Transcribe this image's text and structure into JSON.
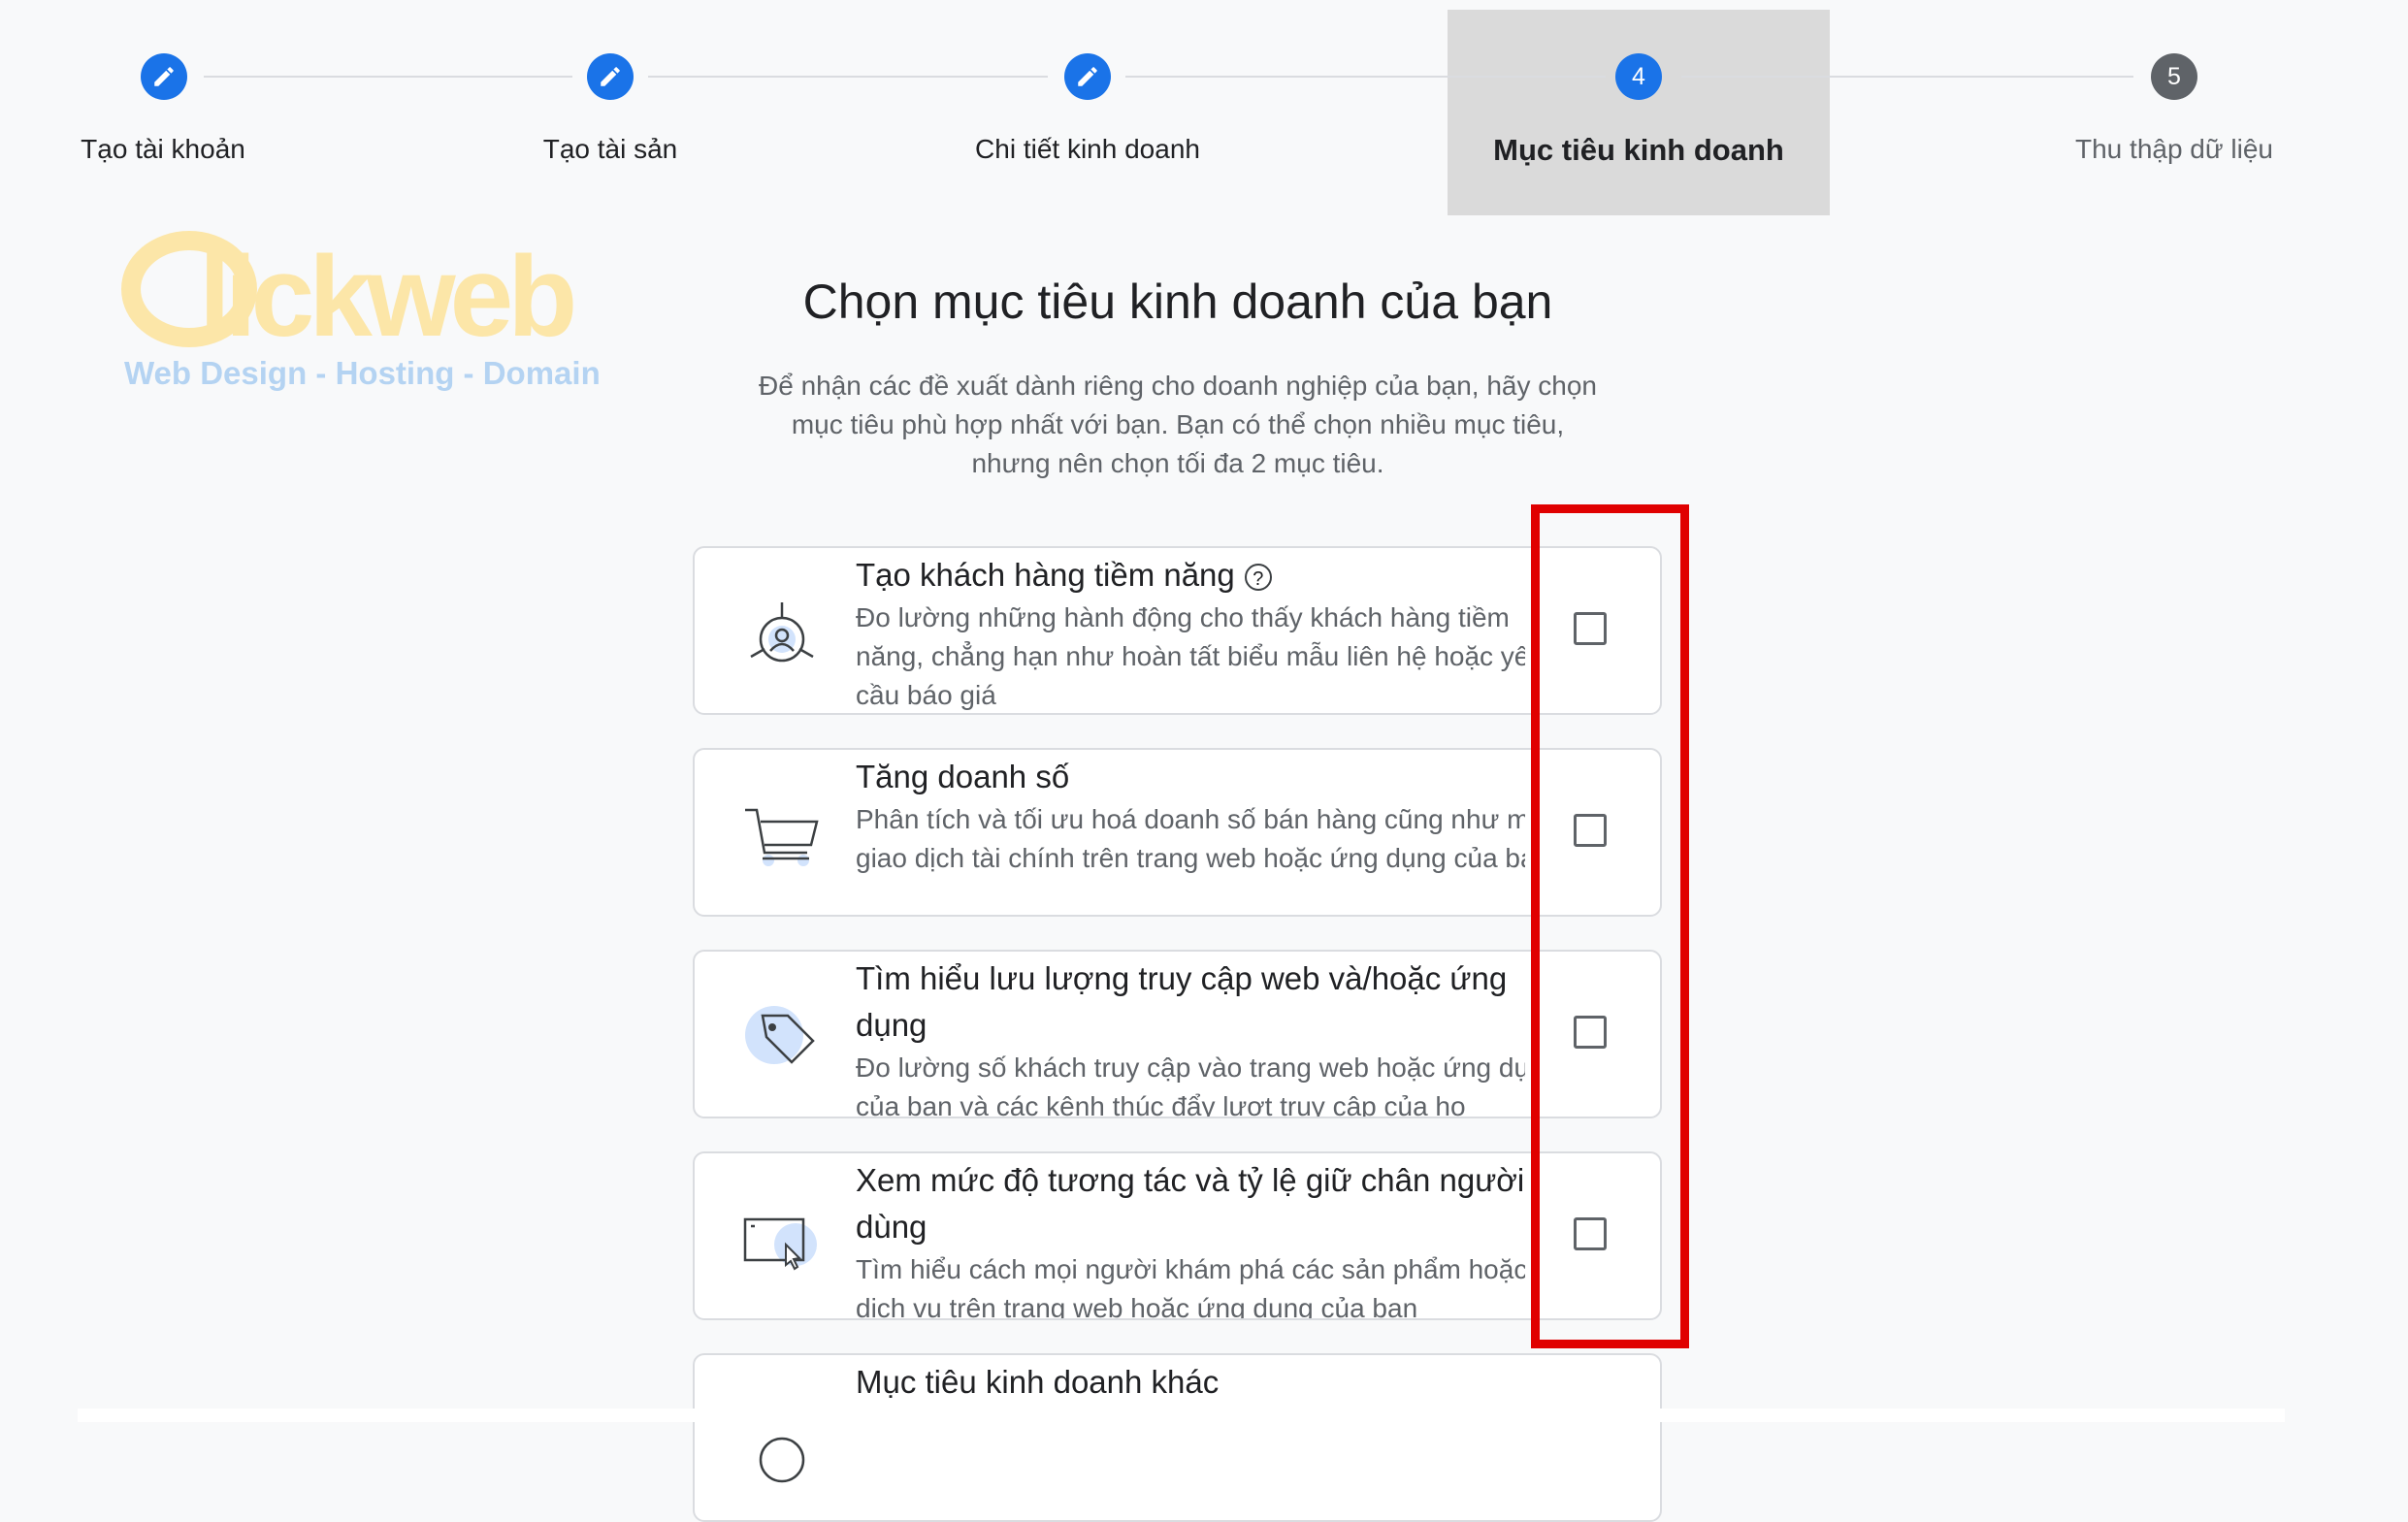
{
  "stepper": {
    "steps": [
      {
        "number": "1",
        "label": "Tạo tài khoản",
        "state": "done",
        "icon": "pencil-icon"
      },
      {
        "number": "2",
        "label": "Tạo tài sản",
        "state": "done",
        "icon": "pencil-icon"
      },
      {
        "number": "3",
        "label": "Chi tiết kinh doanh",
        "state": "done",
        "icon": "pencil-icon"
      },
      {
        "number": "4",
        "label": "Mục tiêu kinh doanh",
        "state": "active"
      },
      {
        "number": "5",
        "label": "Thu thập dữ liệu",
        "state": "pending"
      }
    ]
  },
  "watermark": {
    "brand": "lickweb",
    "tagline": "Web Design - Hosting - Domain"
  },
  "main": {
    "title": "Chọn mục tiêu kinh doanh của bạn",
    "description": "Để nhận các đề xuất dành riêng cho doanh nghiệp của bạn, hãy chọn mục tiêu phù hợp nhất với bạn. Bạn có thể chọn nhiều mục tiêu, nhưng nên chọn tối đa 2 mục tiêu."
  },
  "goals": [
    {
      "title": "Tạo khách hàng tiềm năng",
      "description": "Đo lường những hành động cho thấy khách hàng tiềm năng, chẳng hạn như hoàn tất biểu mẫu liên hệ hoặc yêu cầu báo giá",
      "icon": "lead-target-icon",
      "has_help": true,
      "checked": false
    },
    {
      "title": "Tăng doanh số",
      "description": "Phân tích và tối ưu hoá doanh số bán hàng cũng như mọi giao dịch tài chính trên trang web hoặc ứng dụng của bạn",
      "icon": "shopping-cart-icon",
      "has_help": false,
      "checked": false
    },
    {
      "title": "Tìm hiểu lưu lượng truy cập web và/hoặc ứng dụng",
      "description": "Đo lường số khách truy cập vào trang web hoặc ứng dụng của bạn và các kênh thúc đẩy lượt truy cập của họ",
      "icon": "tag-icon",
      "has_help": false,
      "checked": false
    },
    {
      "title": "Xem mức độ tương tác và tỷ lệ giữ chân người dùng",
      "description": "Tìm hiểu cách mọi người khám phá các sản phẩm hoặc dịch vụ trên trang web hoặc ứng dụng của bạn",
      "icon": "browser-cursor-icon",
      "has_help": false,
      "checked": false
    },
    {
      "title": "Mục tiêu kinh doanh khác",
      "description": "",
      "icon": "other-goal-icon",
      "has_help": false,
      "checked": false
    }
  ],
  "help_icon_glyph": "?",
  "colors": {
    "accent": "#1a73e8",
    "pending_step": "#5f6368",
    "highlight_box": "#e00000",
    "active_step_bg": "#dadada"
  }
}
